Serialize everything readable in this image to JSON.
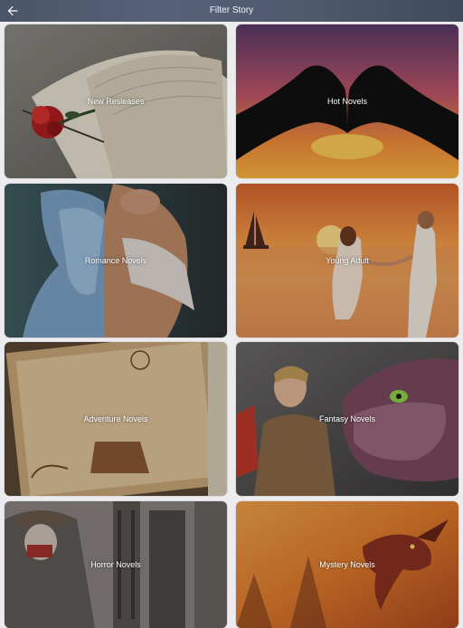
{
  "header": {
    "title": "Filter Story",
    "back_icon": "back-arrow-icon"
  },
  "categories": [
    {
      "label": "New Resleases"
    },
    {
      "label": "Hot Novels"
    },
    {
      "label": "Romance Novels"
    },
    {
      "label": "Young Adult"
    },
    {
      "label": "Adventure Novels"
    },
    {
      "label": "Fantasy Novels"
    },
    {
      "label": "Horror Novels"
    },
    {
      "label": "Mystery Novels"
    }
  ],
  "colors": {
    "background": "#ececee",
    "header": "#4f5a6d"
  }
}
